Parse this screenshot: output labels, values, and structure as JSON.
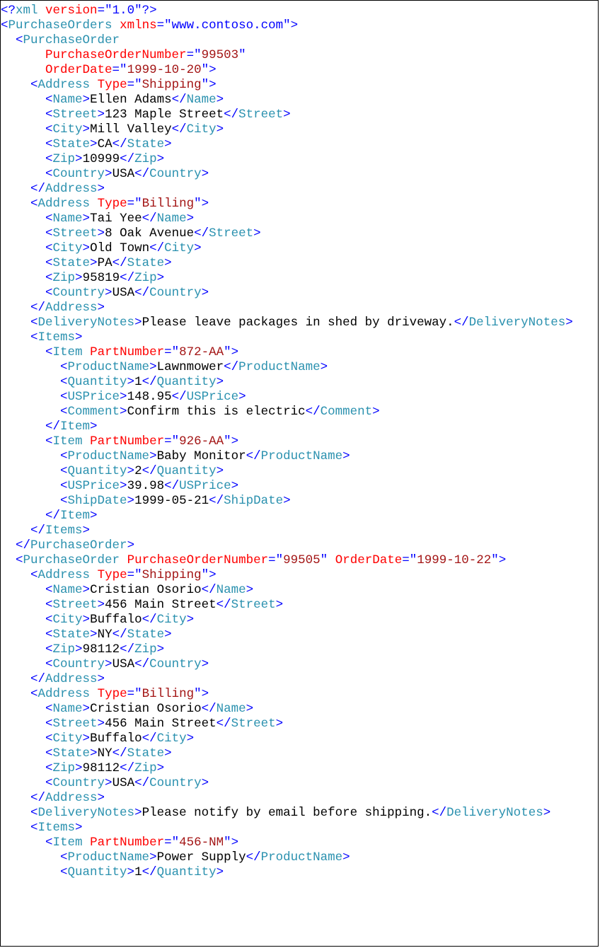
{
  "xml_declaration": {
    "version": "1.0"
  },
  "root": {
    "name": "PurchaseOrders",
    "xmlns": "www.contoso.com",
    "orders": [
      {
        "PurchaseOrderNumber": "99503",
        "OrderDate": "1999-10-20",
        "addresses": [
          {
            "Type": "Shipping",
            "Name": "Ellen Adams",
            "Street": "123 Maple Street",
            "City": "Mill Valley",
            "State": "CA",
            "Zip": "10999",
            "Country": "USA"
          },
          {
            "Type": "Billing",
            "Name": "Tai Yee",
            "Street": "8 Oak Avenue",
            "City": "Old Town",
            "State": "PA",
            "Zip": "95819",
            "Country": "USA"
          }
        ],
        "DeliveryNotes": "Please leave packages in shed by driveway.",
        "Items": [
          {
            "PartNumber": "872-AA",
            "ProductName": "Lawnmower",
            "Quantity": "1",
            "USPrice": "148.95",
            "Comment": "Confirm this is electric"
          },
          {
            "PartNumber": "926-AA",
            "ProductName": "Baby Monitor",
            "Quantity": "2",
            "USPrice": "39.98",
            "ShipDate": "1999-05-21"
          }
        ]
      },
      {
        "PurchaseOrderNumber": "99505",
        "OrderDate": "1999-10-22",
        "addresses": [
          {
            "Type": "Shipping",
            "Name": "Cristian Osorio",
            "Street": "456 Main Street",
            "City": "Buffalo",
            "State": "NY",
            "Zip": "98112",
            "Country": "USA"
          },
          {
            "Type": "Billing",
            "Name": "Cristian Osorio",
            "Street": "456 Main Street",
            "City": "Buffalo",
            "State": "NY",
            "Zip": "98112",
            "Country": "USA"
          }
        ],
        "DeliveryNotes": "Please notify by email before shipping.",
        "Items": [
          {
            "PartNumber": "456-NM",
            "ProductName": "Power Supply",
            "Quantity": "1"
          }
        ]
      }
    ]
  },
  "labels": {
    "xml": "xml",
    "version": "version",
    "PurchaseOrders": "PurchaseOrders",
    "PurchaseOrder": "PurchaseOrder",
    "xmlns": "xmlns",
    "PurchaseOrderNumber": "PurchaseOrderNumber",
    "OrderDate": "OrderDate",
    "Address": "Address",
    "Type": "Type",
    "Name": "Name",
    "Street": "Street",
    "City": "City",
    "State": "State",
    "Zip": "Zip",
    "Country": "Country",
    "DeliveryNotes": "DeliveryNotes",
    "Items": "Items",
    "Item": "Item",
    "PartNumber": "PartNumber",
    "ProductName": "ProductName",
    "Quantity": "Quantity",
    "USPrice": "USPrice",
    "Comment": "Comment",
    "ShipDate": "ShipDate"
  }
}
